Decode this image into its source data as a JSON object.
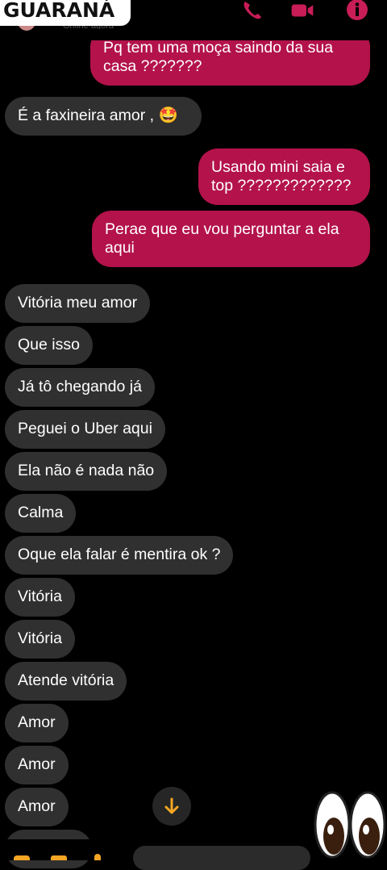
{
  "header": {
    "contact_name": "GUARANÁ",
    "status": "Online agora",
    "icons": [
      "phone-icon",
      "video-camera-icon",
      "info-icon"
    ],
    "accent_color": "#b3124b"
  },
  "messages": [
    {
      "side": "outgoing",
      "lines": [
        "Pq tem uma moça saindo da sua",
        "casa ???????"
      ]
    },
    {
      "side": "incoming",
      "lines": [
        "É a faxineira amor , 🤩"
      ]
    },
    {
      "side": "outgoing",
      "lines": [
        "Usando mini saia e",
        "top ?????????????"
      ]
    },
    {
      "side": "outgoing",
      "lines": [
        "Perae que eu vou perguntar a ela",
        "aqui"
      ]
    },
    {
      "side": "incoming",
      "lines": [
        "Vitória meu amor"
      ]
    },
    {
      "side": "incoming",
      "lines": [
        "Que isso"
      ]
    },
    {
      "side": "incoming",
      "lines": [
        "Já tô chegando já"
      ]
    },
    {
      "side": "incoming",
      "lines": [
        "Peguei o Uber aqui"
      ]
    },
    {
      "side": "incoming",
      "lines": [
        "Ela não é nada não"
      ]
    },
    {
      "side": "incoming",
      "lines": [
        "Calma"
      ]
    },
    {
      "side": "incoming",
      "lines": [
        "Oque ela falar é mentira ok ?"
      ]
    },
    {
      "side": "incoming",
      "lines": [
        "Vitória"
      ]
    },
    {
      "side": "incoming",
      "lines": [
        "Vitória"
      ]
    },
    {
      "side": "incoming",
      "lines": [
        "Atende vitória"
      ]
    },
    {
      "side": "incoming",
      "lines": [
        "Amor"
      ]
    },
    {
      "side": "incoming",
      "lines": [
        "Amor"
      ]
    },
    {
      "side": "incoming",
      "lines": [
        "Amor"
      ]
    }
  ],
  "scroll_button": {
    "icon": "arrow-down-icon",
    "color": "#f5a623"
  },
  "overlay": {
    "icon": "eyes-emoji-icon"
  }
}
